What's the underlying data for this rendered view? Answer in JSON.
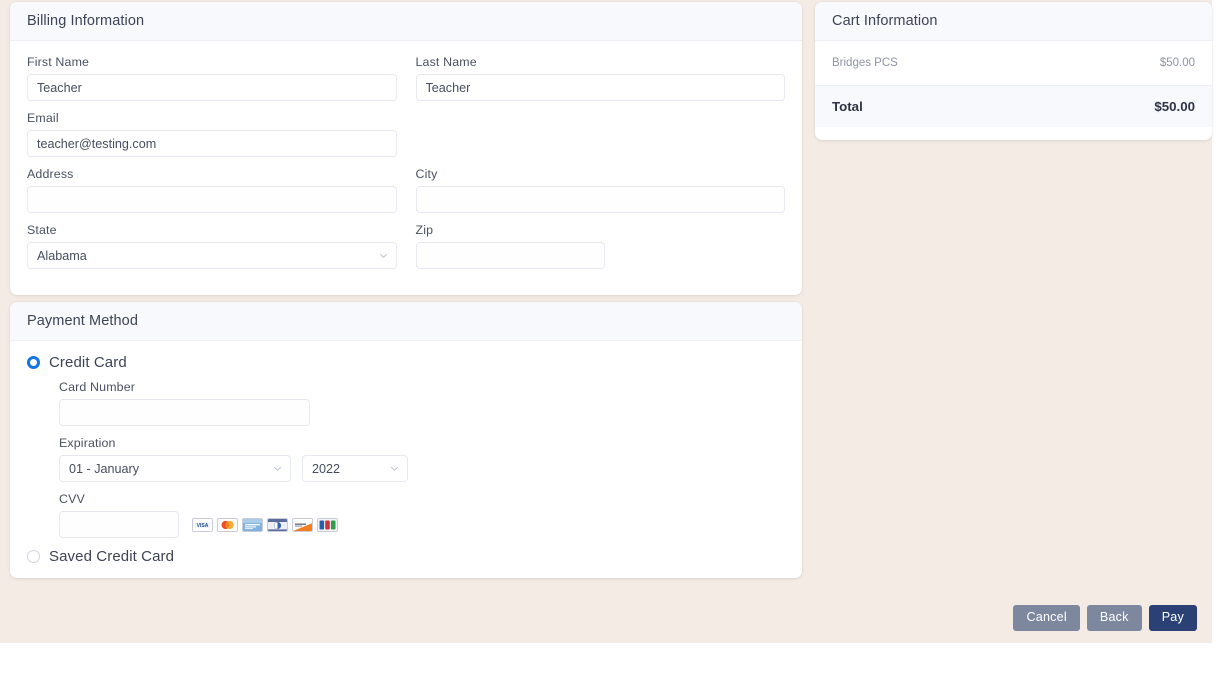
{
  "billing": {
    "title": "Billing Information",
    "fields": {
      "first_name": {
        "label": "First Name",
        "value": "Teacher",
        "placeholder": ""
      },
      "last_name": {
        "label": "Last Name",
        "value": "Teacher",
        "placeholder": ""
      },
      "email": {
        "label": "Email",
        "value": "teacher@testing.com",
        "placeholder": ""
      },
      "address": {
        "label": "Address",
        "value": "",
        "placeholder": ""
      },
      "city": {
        "label": "City",
        "value": "",
        "placeholder": ""
      },
      "state": {
        "label": "State",
        "value": "Alabama",
        "placeholder": ""
      },
      "zip": {
        "label": "Zip",
        "value": "",
        "placeholder": ""
      }
    }
  },
  "payment": {
    "title": "Payment Method",
    "options": {
      "credit_card": "Credit Card",
      "saved_credit_card": "Saved Credit Card"
    },
    "selected": "Credit Card",
    "fields": {
      "card_number": {
        "label": "Card Number",
        "value": "",
        "placeholder": ""
      },
      "expiration": {
        "label": "Expiration",
        "month": "01 - January",
        "year": "2022"
      },
      "cvv": {
        "label": "CVV",
        "value": "",
        "placeholder": ""
      }
    },
    "accepted_cards": [
      "visa-card-icon",
      "mastercard-card-icon",
      "amex-card-icon",
      "diners-club-card-icon",
      "discover-card-icon",
      "jcb-card-icon"
    ]
  },
  "cart": {
    "title": "Cart Information",
    "items": [
      {
        "name": "Bridges PCS",
        "price": "$50.00"
      }
    ],
    "total_label": "Total",
    "total_value": "$50.00"
  },
  "actions": {
    "cancel": "Cancel",
    "back": "Back",
    "pay": "Pay"
  },
  "colors": {
    "page_background": "#f4ece4",
    "card_header": "#f8f9fc",
    "radio_selected": "#1374e6",
    "primary_button": "#2b4175",
    "secondary_button": "#7d879e"
  }
}
